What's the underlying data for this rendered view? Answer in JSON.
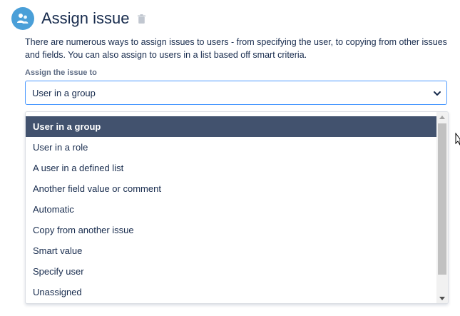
{
  "header": {
    "title": "Assign issue",
    "icon": "users-icon",
    "accent_color": "#4a9fd8"
  },
  "description": "There are numerous ways to assign issues to users - from specifying the user, to copying from other issues and fields. You can also assign to users in a list based off smart criteria.",
  "field": {
    "label": "Assign the issue to",
    "selected_value": "User in a group",
    "border_color": "#4c9aff"
  },
  "dropdown": {
    "selected_index": 0,
    "selected_bg": "#42526e",
    "options": [
      "User in a group",
      "User in a role",
      "A user in a defined list",
      "Another field value or comment",
      "Automatic",
      "Copy from another issue",
      "Smart value",
      "Specify user",
      "Unassigned"
    ]
  }
}
